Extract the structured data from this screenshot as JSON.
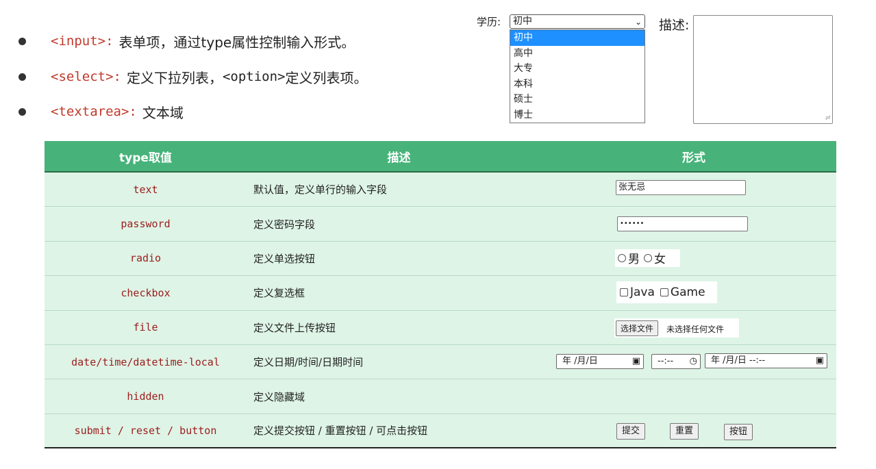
{
  "bullets": [
    {
      "tag": "<input>:",
      "desc": "表单项，通过type属性控制输入形式。"
    },
    {
      "tag": "<select>:",
      "desc": "定义下拉列表，",
      "code": "<option>",
      "desc2": " 定义列表项。"
    },
    {
      "tag": "<textarea>:",
      "desc": "文本域"
    }
  ],
  "select_demo": {
    "label": "学历:",
    "selected": "初中",
    "options": [
      "初中",
      "高中",
      "大专",
      "本科",
      "硕士",
      "博士"
    ],
    "active_index": 0
  },
  "textarea_demo": {
    "label": "描述:",
    "value": ""
  },
  "table": {
    "headers": [
      "type取值",
      "描述",
      "形式"
    ],
    "rows": [
      {
        "type": "text",
        "desc": "默认值，定义单行的输入字段"
      },
      {
        "type": "password",
        "desc": "定义密码字段"
      },
      {
        "type": "radio",
        "desc": "定义单选按钮"
      },
      {
        "type": "checkbox",
        "desc": "定义复选框"
      },
      {
        "type": "file",
        "desc": "定义文件上传按钮"
      },
      {
        "type": "date/time/datetime-local",
        "desc": "定义日期/时间/日期时间"
      },
      {
        "type": "hidden",
        "desc": "定义隐藏域"
      },
      {
        "type": "submit / reset / button",
        "desc": "定义提交按钮 / 重置按钮 / 可点击按钮"
      }
    ],
    "forms": {
      "text_value": "张无忌",
      "password_value": "••••••",
      "radio_labels": [
        "男",
        "女"
      ],
      "checkbox_labels": [
        "Java",
        "Game"
      ],
      "file_button": "选择文件",
      "file_status": "未选择任何文件",
      "date_value": "年 /月/日",
      "time_value": "--:--",
      "datetime_value": "年 /月/日 --:--",
      "buttons": [
        "提交",
        "重置",
        "按钮"
      ]
    }
  }
}
